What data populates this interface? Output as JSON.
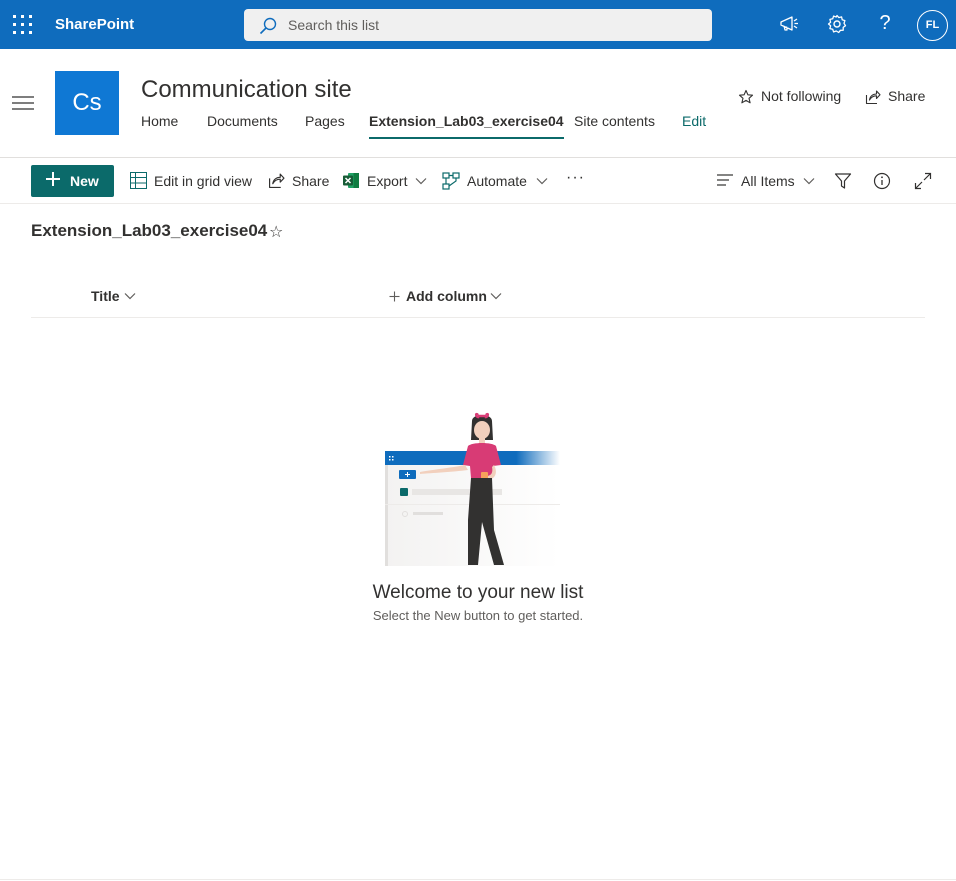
{
  "suitebar": {
    "brand": "SharePoint",
    "search_placeholder": "Search this list",
    "avatar_initials": "FL",
    "help_glyph": "?",
    "icons": [
      "waffle-icon",
      "megaphone-icon",
      "gear-icon",
      "help-icon"
    ],
    "bg_color": "#0f6cbd"
  },
  "site": {
    "logo_text": "Cs",
    "title": "Communication site",
    "nav": [
      {
        "label": "Home"
      },
      {
        "label": "Documents"
      },
      {
        "label": "Pages"
      },
      {
        "label": "Extension_Lab03_exercise04",
        "active": true
      },
      {
        "label": "Site contents"
      },
      {
        "label": "Edit"
      }
    ],
    "follow_label": "Not following",
    "share_label": "Share",
    "logo_color": "#0f78d4"
  },
  "commandbar": {
    "new_label": "New",
    "grid_label": "Edit in grid view",
    "share_label": "Share",
    "export_label": "Export",
    "automate_label": "Automate",
    "more_glyph": "···",
    "view_label": "All Items",
    "accent_color": "#0b6a6a"
  },
  "list": {
    "title": "Extension_Lab03_exercise04",
    "star_glyph": "☆",
    "columns": {
      "title": "Title",
      "add": "Add column"
    },
    "empty_title": "Welcome to your new list",
    "empty_subtitle": "Select the New button to get started."
  }
}
